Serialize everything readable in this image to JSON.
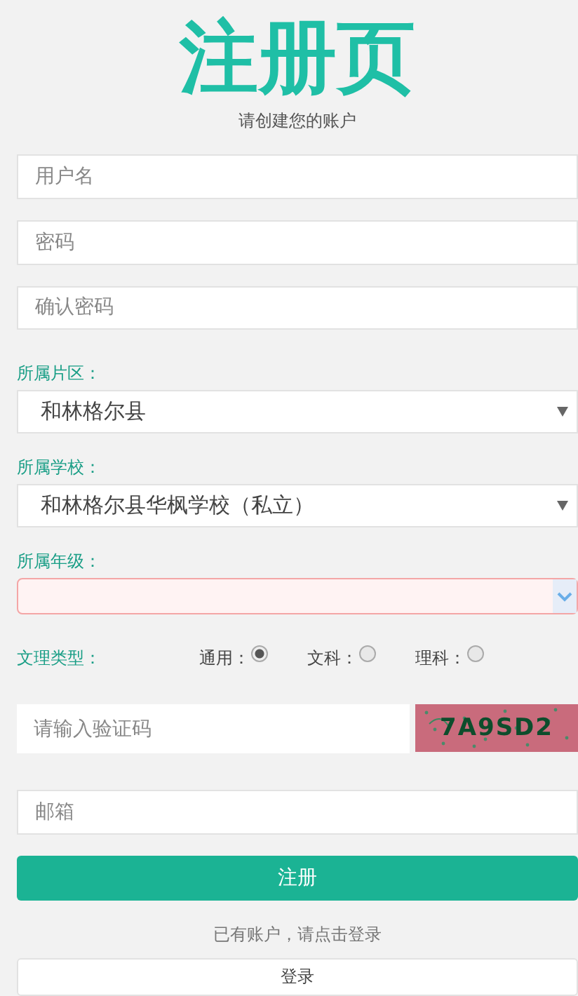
{
  "title": "注册页",
  "subtitle": "请创建您的账户",
  "text_fields": [
    {
      "placeholder": "用户名"
    },
    {
      "placeholder": "密码"
    },
    {
      "placeholder": "确认密码"
    }
  ],
  "selects": [
    {
      "label": "所属片区：",
      "value": "和林格尔县",
      "invalid": false
    },
    {
      "label": "所属学校：",
      "value": "和林格尔县华枫学校（私立）",
      "invalid": false
    },
    {
      "label": "所属年级：",
      "invalid": true
    }
  ],
  "track_type": {
    "label": "文理类型：",
    "options": [
      {
        "label": "通用：",
        "selected": true
      },
      {
        "label": "文科：",
        "selected": false
      },
      {
        "label": "理科：",
        "selected": false
      }
    ]
  },
  "captcha": {
    "placeholder": "请输入验证码",
    "code": "7A9SD2"
  },
  "email": {
    "placeholder": "邮箱"
  },
  "register_button": "注册",
  "login_hint": "已有账户，请点击登录",
  "login_button": "登录"
}
